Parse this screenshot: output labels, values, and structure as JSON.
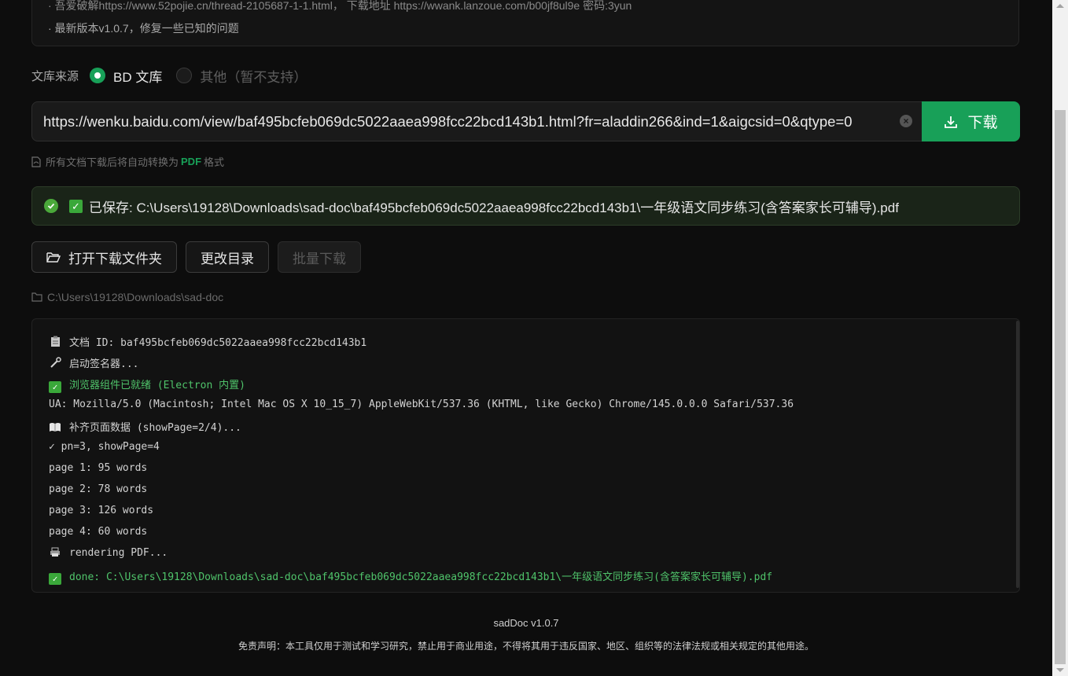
{
  "notice": {
    "line1": "· 吾爱破解https://www.52pojie.cn/thread-2105687-1-1.html，  下载地址 https://wwank.lanzoue.com/b00jf8ul9e 密码:3yun",
    "line2": "· 最新版本v1.0.7，修复一些已知的问题"
  },
  "source": {
    "label": "文库来源",
    "options": [
      {
        "label": "BD 文库",
        "selected": true
      },
      {
        "label": "其他（暂不支持）",
        "selected": false
      }
    ]
  },
  "url_input": {
    "value": "https://wenku.baidu.com/view/baf495bcfeb069dc5022aaea998fcc22bcd143b1.html?fr=aladdin266&ind=1&aigcsid=0&qtype=0"
  },
  "download_button": "下载",
  "hint": {
    "before": "所有文档下载后将自动转换为",
    "pdf": "PDF",
    "after": "格式"
  },
  "saved": {
    "message": "已保存: C:\\Users\\19128\\Downloads\\sad-doc\\baf495bcfeb069dc5022aaea998fcc22bcd143b1\\一年级语文同步练习(含答案家长可辅导).pdf"
  },
  "buttons": {
    "open_folder": "打开下载文件夹",
    "change_dir": "更改目录",
    "batch": "批量下载"
  },
  "directory": "C:\\Users\\19128\\Downloads\\sad-doc",
  "log": [
    {
      "icon": "clipboard-icon",
      "text": "文档 ID: baf495bcfeb069dc5022aaea998fcc22bcd143b1",
      "color": "#d2d2d2"
    },
    {
      "icon": "wrench-icon",
      "text": "启动签名器...",
      "color": "#d2d2d2"
    },
    {
      "icon": "check-icon",
      "text": "浏览器组件已就绪 (Electron 内置)",
      "color": "#4fc36a"
    },
    {
      "icon": "",
      "text": "UA: Mozilla/5.0 (Macintosh; Intel Mac OS X 10_15_7) AppleWebKit/537.36 (KHTML, like Gecko) Chrome/145.0.0.0 Safari/537.36",
      "color": "#d2d2d2"
    },
    {
      "icon": "book-icon",
      "text": "补齐页面数据 (showPage=2/4)...",
      "color": "#d2d2d2"
    },
    {
      "icon": "",
      "text": "✓ pn=3, showPage=4",
      "color": "#d2d2d2"
    },
    {
      "icon": "",
      "text": "page 1: 95 words",
      "color": "#d2d2d2"
    },
    {
      "icon": "",
      "text": "page 2: 78 words",
      "color": "#d2d2d2"
    },
    {
      "icon": "",
      "text": "page 3: 126 words",
      "color": "#d2d2d2"
    },
    {
      "icon": "",
      "text": "page 4: 60 words",
      "color": "#d2d2d2"
    },
    {
      "icon": "printer-icon",
      "text": "rendering PDF...",
      "color": "#d2d2d2"
    },
    {
      "icon": "check-icon",
      "text": "done: C:\\Users\\19128\\Downloads\\sad-doc\\baf495bcfeb069dc5022aaea998fcc22bcd143b1\\一年级语文同步练习(含答案家长可辅导).pdf",
      "color": "#4fc36a"
    }
  ],
  "footer": {
    "version": "sadDoc v1.0.7",
    "disclaimer": "免责声明：本工具仅用于测试和学习研究，禁止用于商业用途，不得将其用于违反国家、地区、组织等的法律法规或相关规定的其他用途。"
  },
  "colors": {
    "accent": "#18a058",
    "background": "#0d0d0d",
    "success_text": "#4fc36a"
  }
}
